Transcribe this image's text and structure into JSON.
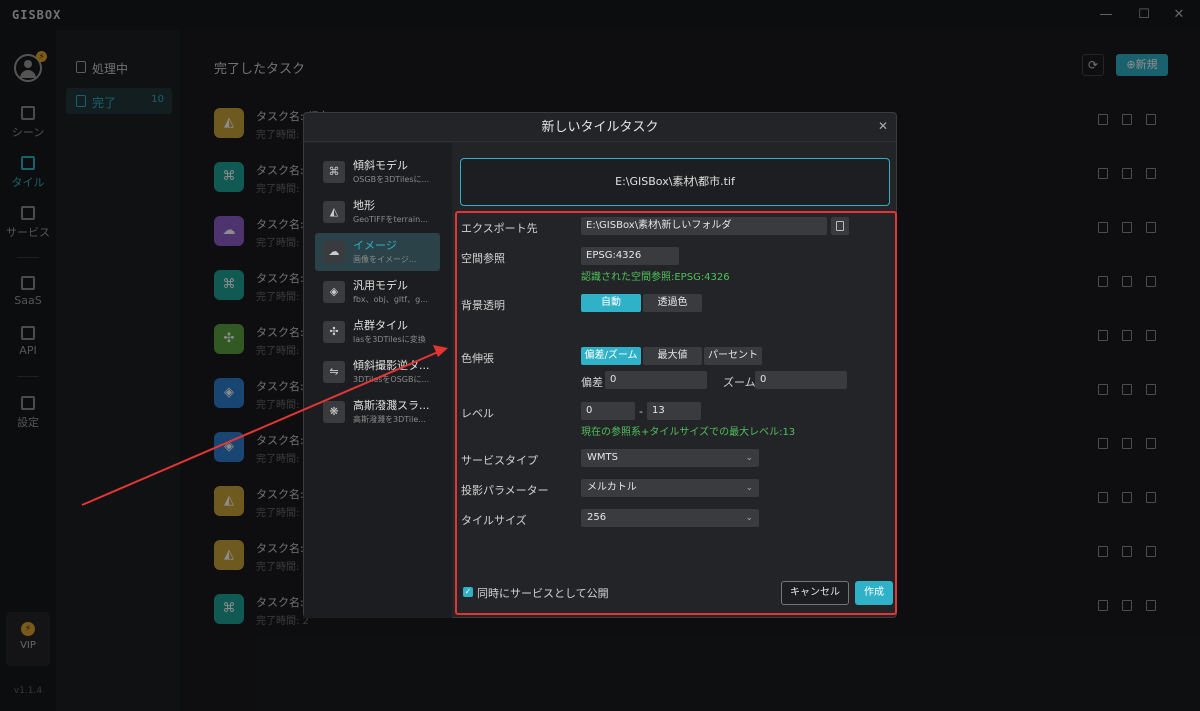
{
  "window": {
    "logo": "GISBOX",
    "min": "—",
    "max": "☐",
    "close": "✕"
  },
  "nav": {
    "avatar_badge": "⚡",
    "items": [
      {
        "label": "シーン",
        "icon": "home-icon"
      },
      {
        "label": "タイル",
        "icon": "tile-icon"
      },
      {
        "label": "サービス",
        "icon": "service-icon"
      },
      {
        "label": "SaaS",
        "icon": "lock-icon"
      },
      {
        "label": "API",
        "icon": "link-icon"
      },
      {
        "label": "設定",
        "icon": "gear-icon"
      }
    ],
    "vip_icon": "⚡",
    "vip_label": "VIP",
    "version": "v1.1.4"
  },
  "subnav": {
    "processing": "処理中",
    "done": "完了",
    "done_count": "10"
  },
  "main": {
    "title": "完了したタスク",
    "refresh_icon": "⟳",
    "new_label": "⊕新規",
    "tasks": [
      {
        "name": "タスク名: 都市",
        "time": "完了時間: 2",
        "color": "#c9a23a",
        "icon": "◭"
      },
      {
        "name": "タスク名:",
        "time": "完了時間: 2",
        "color": "#1fa59a",
        "icon": "⌘"
      },
      {
        "name": "タスク名:",
        "time": "完了時間: 2",
        "color": "#8e5fc8",
        "icon": "☁"
      },
      {
        "name": "タスク名:",
        "time": "完了時間: 2",
        "color": "#1fa59a",
        "icon": "⌘"
      },
      {
        "name": "タスク名:",
        "time": "完了時間: 2",
        "color": "#5ba043",
        "icon": "✣"
      },
      {
        "name": "タスク名:",
        "time": "完了時間: 2",
        "color": "#2f7fd0",
        "icon": "◈"
      },
      {
        "name": "タスク名:",
        "time": "完了時間: 2",
        "color": "#2f7fd0",
        "icon": "◈"
      },
      {
        "name": "タスク名:",
        "time": "完了時間: 2",
        "color": "#c9a23a",
        "icon": "◭"
      },
      {
        "name": "タスク名:",
        "time": "完了時間: 2",
        "color": "#c9a23a",
        "icon": "◭"
      },
      {
        "name": "タスク名:",
        "time": "完了時間: 2",
        "color": "#1fa59a",
        "icon": "⌘"
      }
    ]
  },
  "dialog": {
    "title": "新しいタイルタスク",
    "close": "✕",
    "types": [
      {
        "name": "傾斜モデル",
        "desc": "OSGBを3DTilesに...",
        "icon": "⌘"
      },
      {
        "name": "地形",
        "desc": "GeoTIFFをterrain...",
        "icon": "◭"
      },
      {
        "name": "イメージ",
        "desc": "画像をイメージ...",
        "icon": "☁"
      },
      {
        "name": "汎用モデル",
        "desc": "fbx、obj、gltf、g...",
        "icon": "◈"
      },
      {
        "name": "点群タイル",
        "desc": "lasを3DTilesに変換",
        "icon": "✣"
      },
      {
        "name": "傾斜撮影逆タ...",
        "desc": "3DTilesをOSGBに...",
        "icon": "⇋"
      },
      {
        "name": "高斯潑濺スラ...",
        "desc": "高斯潑濺を3DTile...",
        "icon": "❋"
      }
    ],
    "file_path": "E:\\GISBox\\素材\\都市.tif",
    "export_label": "エクスポート先",
    "export_value": "E:\\GISBox\\素材\\新しいフォルダ",
    "crs_label": "空間参照",
    "crs_value": "EPSG:4326",
    "crs_hint": "認識された空間参照:EPSG:4326",
    "bg_label": "背景透明",
    "bg_auto": "自動",
    "bg_transparent": "透過色",
    "stretch_label": "色伸張",
    "stretch_opt1": "偏差/ズーム",
    "stretch_opt2": "最大値",
    "stretch_opt3": "パーセント",
    "deviation_label": "偏差",
    "deviation_value": "0",
    "zoom_label": "ズーム",
    "zoom_value": "0",
    "level_label": "レベル",
    "level_min": "0",
    "level_sep": "-",
    "level_max": "13",
    "level_hint": "現在の参照系+タイルサイズでの最大レベル:13",
    "service_type_label": "サービスタイプ",
    "service_type_value": "WMTS",
    "projection_label": "投影パラメーター",
    "projection_value": "メルカトル",
    "tile_size_label": "タイルサイズ",
    "tile_size_value": "256",
    "publish_label": "同時にサービスとして公開",
    "publish_checked": "✓",
    "cancel": "キャンセル",
    "create": "作成"
  }
}
